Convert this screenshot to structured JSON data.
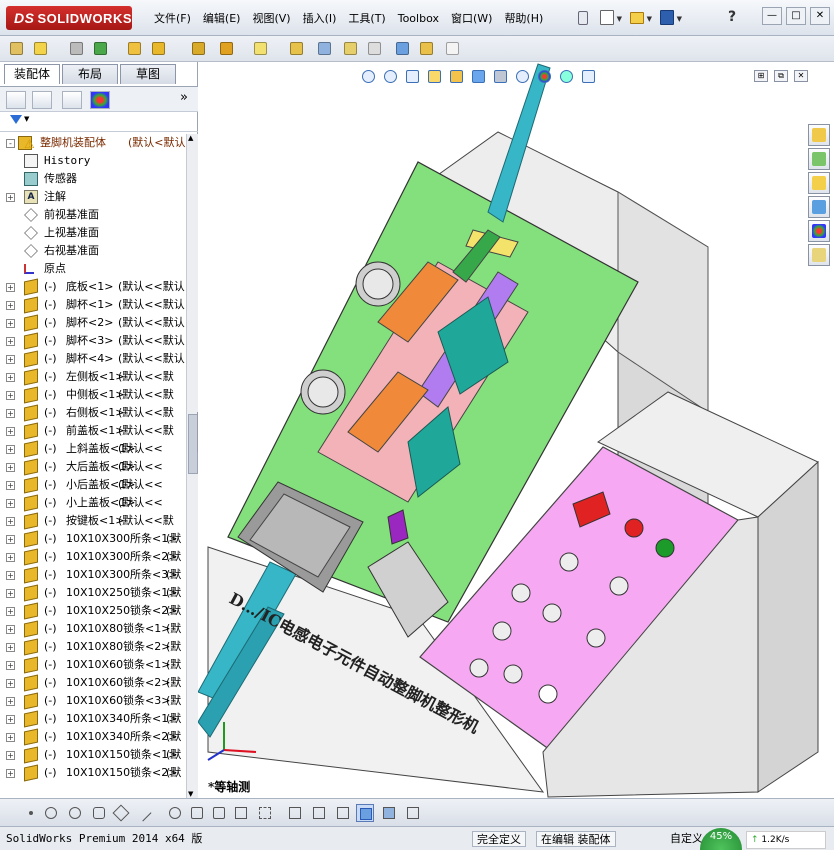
{
  "app": {
    "brand": "SOLIDWORKS",
    "brand_prefix": "DS",
    "menus": [
      "文件(F)",
      "编辑(E)",
      "视图(V)",
      "插入(I)",
      "工具(T)",
      "Toolbox",
      "窗口(W)",
      "帮助(H)"
    ]
  },
  "feature_manager": {
    "tabs": [
      "装配体",
      "布局",
      "草图"
    ],
    "active_tab": "装配体",
    "root": {
      "label": "整脚机装配体",
      "config": "(默认<默认"
    },
    "items": [
      {
        "expand": "",
        "icon": "history",
        "prefix": "",
        "label": "History",
        "config": ""
      },
      {
        "expand": "",
        "icon": "sensor",
        "prefix": "",
        "label": "传感器",
        "config": ""
      },
      {
        "expand": "+",
        "icon": "annotation",
        "prefix": "",
        "label": "注解",
        "config": ""
      },
      {
        "expand": "",
        "icon": "plane",
        "prefix": "",
        "label": "前视基准面",
        "config": ""
      },
      {
        "expand": "",
        "icon": "plane",
        "prefix": "",
        "label": "上视基准面",
        "config": ""
      },
      {
        "expand": "",
        "icon": "plane",
        "prefix": "",
        "label": "右视基准面",
        "config": ""
      },
      {
        "expand": "",
        "icon": "origin",
        "prefix": "",
        "label": "原点",
        "config": ""
      },
      {
        "expand": "+",
        "icon": "part",
        "prefix": "(-)",
        "label": "底板<1>",
        "config": "(默认<<默认"
      },
      {
        "expand": "+",
        "icon": "part",
        "prefix": "(-)",
        "label": "脚杯<1>",
        "config": "(默认<<默认"
      },
      {
        "expand": "+",
        "icon": "part",
        "prefix": "(-)",
        "label": "脚杯<2>",
        "config": "(默认<<默认"
      },
      {
        "expand": "+",
        "icon": "part",
        "prefix": "(-)",
        "label": "脚杯<3>",
        "config": "(默认<<默认"
      },
      {
        "expand": "+",
        "icon": "part",
        "prefix": "(-)",
        "label": "脚杯<4>",
        "config": "(默认<<默认"
      },
      {
        "expand": "+",
        "icon": "part",
        "prefix": "(-)",
        "label": "左侧板<1>",
        "config": "(默认<<默"
      },
      {
        "expand": "+",
        "icon": "part",
        "prefix": "(-)",
        "label": "中侧板<1>",
        "config": "(默认<<默"
      },
      {
        "expand": "+",
        "icon": "part",
        "prefix": "(-)",
        "label": "右侧板<1>",
        "config": "(默认<<默"
      },
      {
        "expand": "+",
        "icon": "part",
        "prefix": "(-)",
        "label": "前盖板<1>",
        "config": "(默认<<默"
      },
      {
        "expand": "+",
        "icon": "part",
        "prefix": "(-)",
        "label": "上斜盖板<1>",
        "config": "(默认<<"
      },
      {
        "expand": "+",
        "icon": "part",
        "prefix": "(-)",
        "label": "大后盖板<1>",
        "config": "(默认<<"
      },
      {
        "expand": "+",
        "icon": "part",
        "prefix": "(-)",
        "label": "小后盖板<1>",
        "config": "(默认<<"
      },
      {
        "expand": "+",
        "icon": "part",
        "prefix": "(-)",
        "label": "小上盖板<1>",
        "config": "(默认<<"
      },
      {
        "expand": "+",
        "icon": "part",
        "prefix": "(-)",
        "label": "按键板<1>",
        "config": "(默认<<默"
      },
      {
        "expand": "+",
        "icon": "part",
        "prefix": "(-)",
        "label": "10X10X300所条<1>",
        "config": "(默"
      },
      {
        "expand": "+",
        "icon": "part",
        "prefix": "(-)",
        "label": "10X10X300所条<2>",
        "config": "(默"
      },
      {
        "expand": "+",
        "icon": "part",
        "prefix": "(-)",
        "label": "10X10X300所条<3>",
        "config": "(默"
      },
      {
        "expand": "+",
        "icon": "part",
        "prefix": "(-)",
        "label": "10X10X250锁条<1>",
        "config": "(默"
      },
      {
        "expand": "+",
        "icon": "part",
        "prefix": "(-)",
        "label": "10X10X250锁条<2>",
        "config": "(默"
      },
      {
        "expand": "+",
        "icon": "part",
        "prefix": "(-)",
        "label": "10X10X80锁条<1>",
        "config": "(默"
      },
      {
        "expand": "+",
        "icon": "part",
        "prefix": "(-)",
        "label": "10X10X80锁条<2>",
        "config": "(默"
      },
      {
        "expand": "+",
        "icon": "part",
        "prefix": "(-)",
        "label": "10X10X60锁条<1>",
        "config": "(默"
      },
      {
        "expand": "+",
        "icon": "part",
        "prefix": "(-)",
        "label": "10X10X60锁条<2>",
        "config": "(默"
      },
      {
        "expand": "+",
        "icon": "part",
        "prefix": "(-)",
        "label": "10X10X60锁条<3>",
        "config": "(默"
      },
      {
        "expand": "+",
        "icon": "part",
        "prefix": "(-)",
        "label": "10X10X340所条<1>",
        "config": "(默"
      },
      {
        "expand": "+",
        "icon": "part",
        "prefix": "(-)",
        "label": "10X10X340所条<2>",
        "config": "(默"
      },
      {
        "expand": "+",
        "icon": "part",
        "prefix": "(-)",
        "label": "10X10X150锁条<1>",
        "config": "(默"
      },
      {
        "expand": "+",
        "icon": "part",
        "prefix": "(-)",
        "label": "10X10X150锁条<2>",
        "config": "(默"
      }
    ]
  },
  "viewport": {
    "machine_label": "D…/IC电感电子元件自动整脚机整形机",
    "view_name": "*等轴测",
    "colors": {
      "plate_green": "#7fe07a",
      "panel_pink": "#f4a8f0",
      "body_grey": "#e8e8e8",
      "rail_cyan": "#35b8c8",
      "block_teal": "#1fa89a",
      "button_red": "#e02222",
      "button_green": "#1c9a2a"
    }
  },
  "statusbar": {
    "product": "SolidWorks Premium 2014 x64 版",
    "fully_defined": "完全定义",
    "editing": "在编辑 装配体",
    "custom": "自定义",
    "speed_percent": "45%",
    "net_speed": "1.2K/s"
  }
}
